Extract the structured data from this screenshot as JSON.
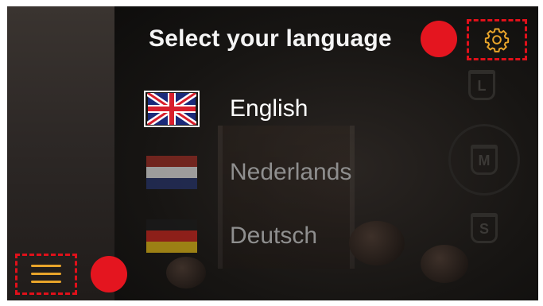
{
  "title": "Select your language",
  "languages": [
    {
      "label": "English",
      "flag": "uk-flag-icon",
      "selected": true
    },
    {
      "label": "Nederlands",
      "flag": "netherlands-flag-icon",
      "selected": false
    },
    {
      "label": "Deutsch",
      "flag": "germany-flag-icon",
      "selected": false
    }
  ],
  "size_indicators": [
    "L",
    "M",
    "S"
  ],
  "icons": {
    "settings": "gear-icon",
    "menu": "hamburger-menu-icon"
  },
  "colors": {
    "accent_orange": "#e8a42a",
    "highlight_red": "#e0101a",
    "text_active": "#ffffff",
    "text_inactive": "#8f8f8f"
  }
}
